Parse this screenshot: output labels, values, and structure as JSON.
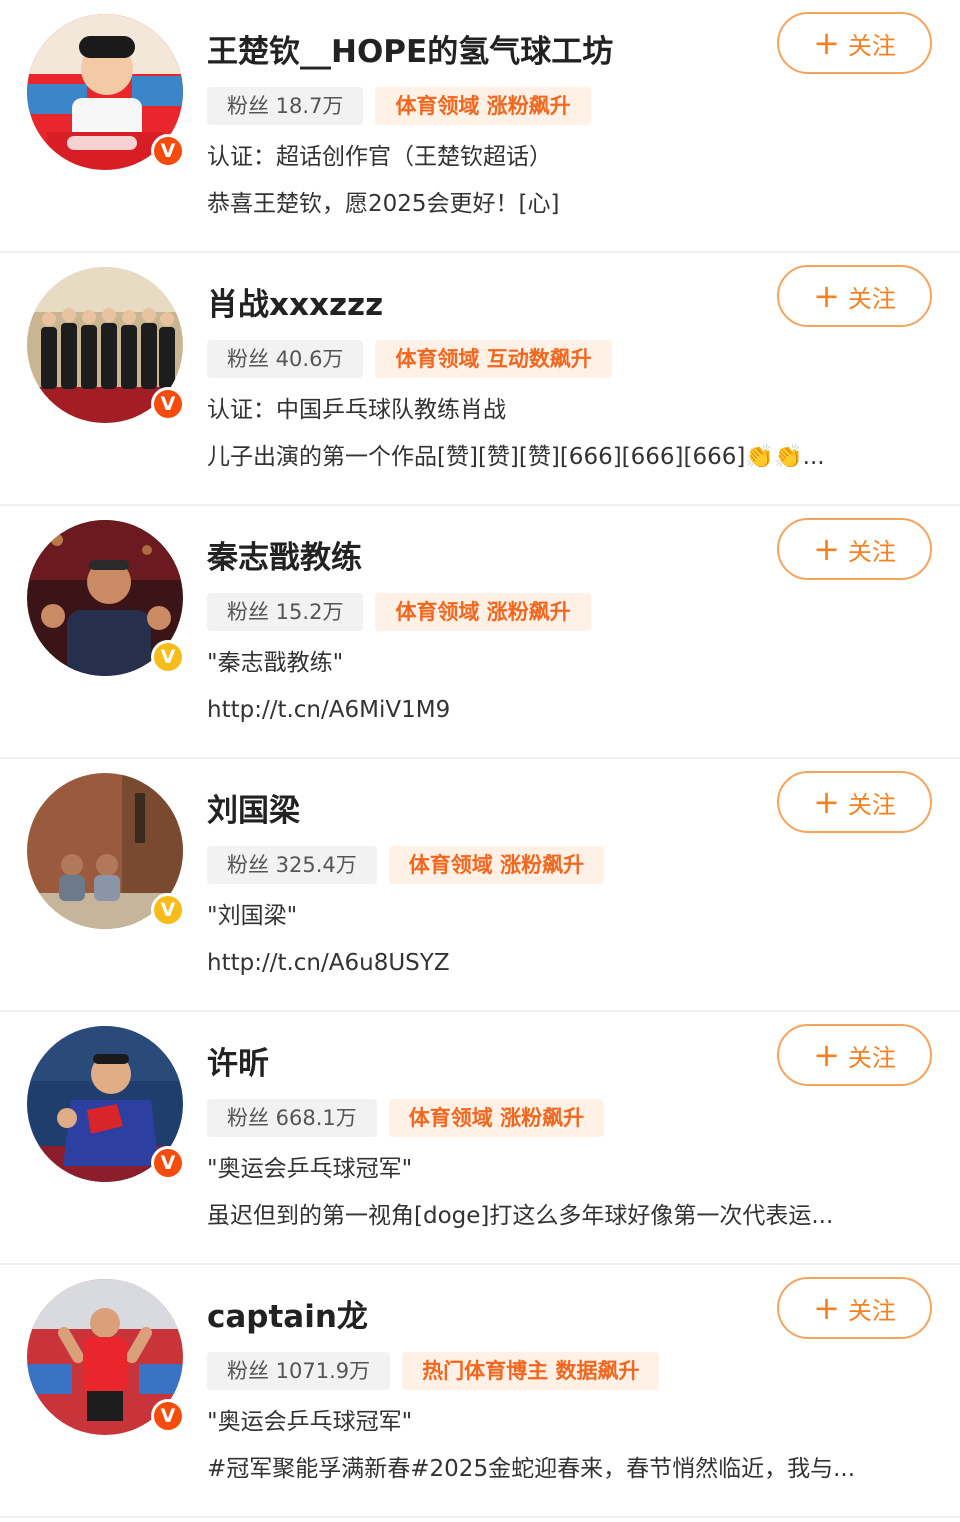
{
  "colors": {
    "accent": "#f7801f",
    "verified_orange": "#f54c0d",
    "verified_gold": "#f7bb1a",
    "field_tag_text": "#f2671f",
    "field_tag_bg": "#fff1e6"
  },
  "follow_label": "关注",
  "follow_icon": "plus-icon",
  "users": [
    {
      "name": "王楚钦__HOPE的氢气球工坊",
      "fans": "粉丝 18.7万",
      "field": "体育领域 涨粉飙升",
      "line1": "认证：超话创作官（王楚钦超话）",
      "line2": "恭喜王楚钦，愿2025会更好！[心]",
      "badge": "verified-orange"
    },
    {
      "name": "肖战xxxzzz",
      "fans": "粉丝 40.6万",
      "field": "体育领域 互动数飙升",
      "line1": "认证：中国乒乓球队教练肖战",
      "line2": "儿子出演的第一个作品[赞][赞][赞][666][666][666]👏👏...",
      "badge": "verified-orange"
    },
    {
      "name": "秦志戬教练",
      "fans": "粉丝 15.2万",
      "field": "体育领域 涨粉飙升",
      "line1": "\"秦志戬教练\"",
      "line2": "http://t.cn/A6MiV1M9",
      "badge": "verified-gold"
    },
    {
      "name": "刘国梁",
      "fans": "粉丝 325.4万",
      "field": "体育领域 涨粉飙升",
      "line1": "\"刘国梁\"",
      "line2": "http://t.cn/A6u8USYZ",
      "badge": "verified-gold"
    },
    {
      "name": "许昕",
      "fans": "粉丝 668.1万",
      "field": "体育领域 涨粉飙升",
      "line1": "\"奥运会乒乓球冠军\"",
      "line2": "虽迟但到的第一视角[doge]打这么多年球好像第一次代表运...",
      "badge": "verified-orange"
    },
    {
      "name": "captain龙",
      "fans": "粉丝 1071.9万",
      "field": "热门体育博主 数据飙升",
      "line1": "\"奥运会乒乓球冠军\"",
      "line2": "#冠军聚能孚满新春#2025金蛇迎春来，春节悄然临近，我与...",
      "badge": "verified-orange"
    }
  ]
}
